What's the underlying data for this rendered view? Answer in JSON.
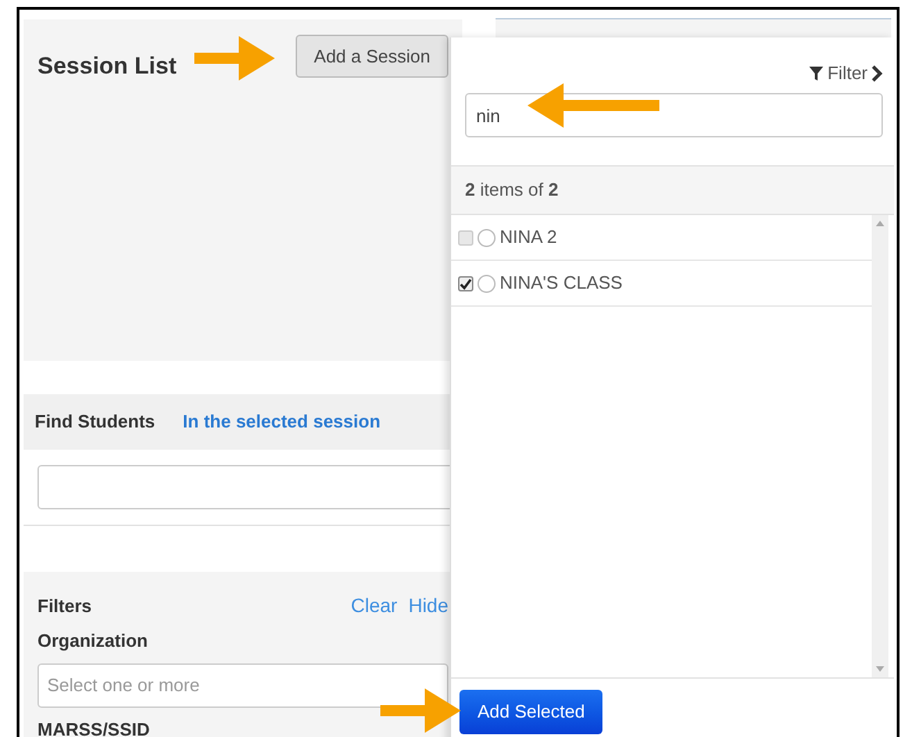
{
  "session_list": {
    "title": "Session List",
    "add_button": "Add a Session"
  },
  "find_students": {
    "title": "Find Students",
    "scope_link": "In the selected session"
  },
  "filters": {
    "title": "Filters",
    "clear": "Clear",
    "hide": "Hide",
    "organization": {
      "label": "Organization",
      "placeholder": "Select one or more"
    },
    "marss_label": "MARSS/SSID"
  },
  "popup": {
    "filter": "Filter",
    "search_value": "nin",
    "count": "**2** items of **2**",
    "items": [
      {
        "label": "NINA 2",
        "checked": false,
        "selected": false
      },
      {
        "label": "NINA'S CLASS",
        "checked": true,
        "selected": false
      }
    ],
    "add_button": "Add Selected"
  }
}
